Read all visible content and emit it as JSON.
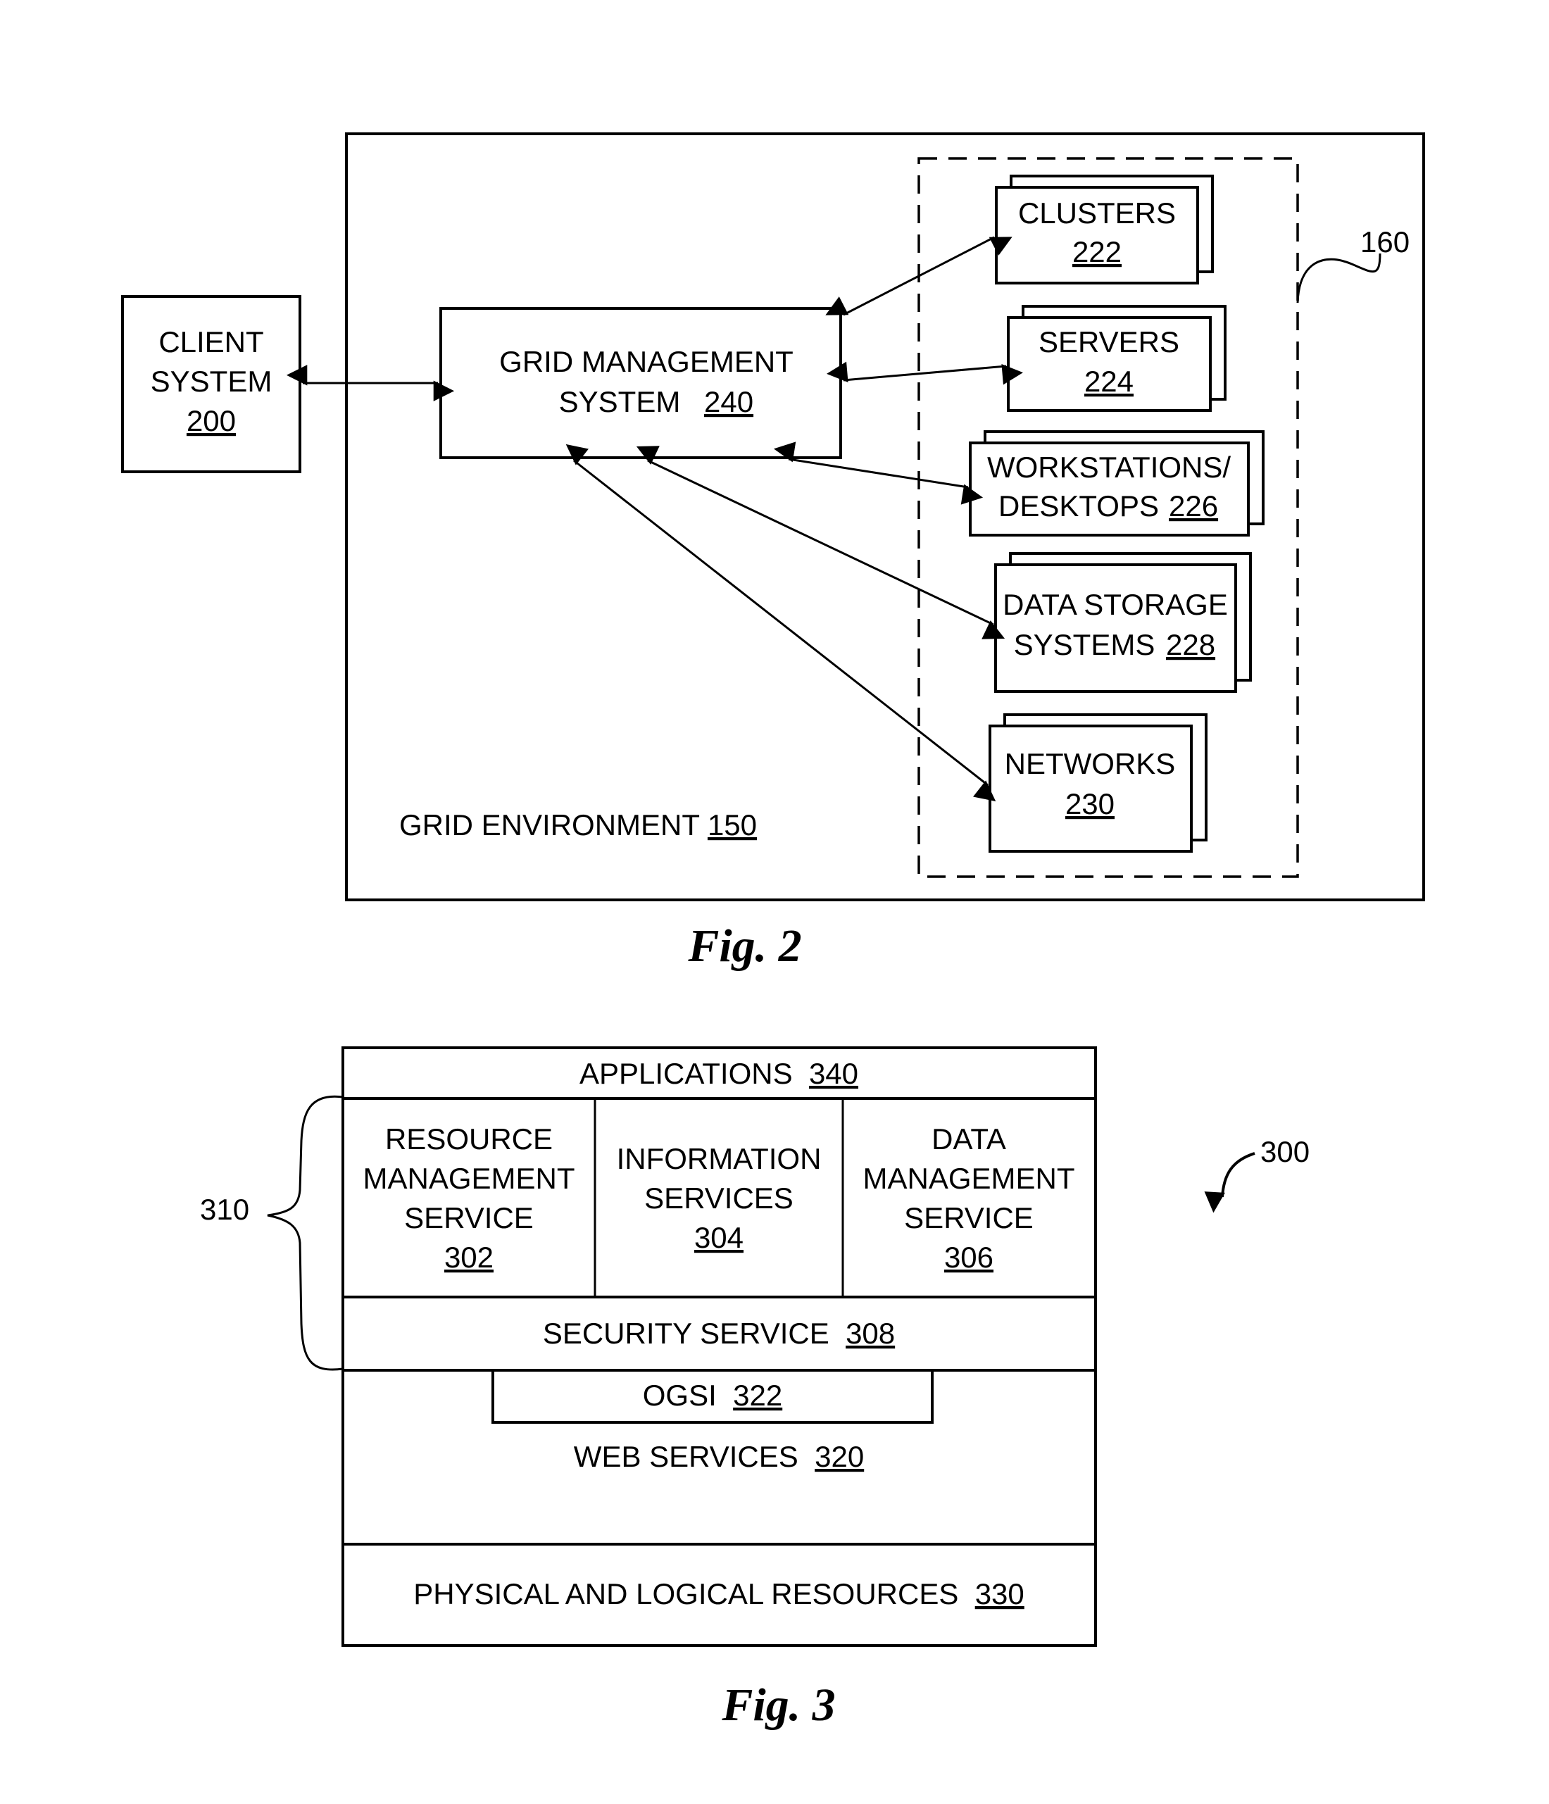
{
  "fig2": {
    "caption": "Fig. 2",
    "grid_environment": {
      "label": "GRID ENVIRONMENT",
      "ref": "150"
    },
    "resource_group_ref": "160",
    "client_system": {
      "lines": [
        "CLIENT",
        "SYSTEM"
      ],
      "ref": "200"
    },
    "grid_management_system": {
      "lines": [
        "GRID MANAGEMENT",
        "SYSTEM"
      ],
      "ref": "240"
    },
    "resources": [
      {
        "id": "clusters",
        "lines": [
          "CLUSTERS"
        ],
        "ref": "222"
      },
      {
        "id": "servers",
        "lines": [
          "SERVERS"
        ],
        "ref": "224"
      },
      {
        "id": "workstations",
        "lines": [
          "WORKSTATIONS/",
          "DESKTOPS"
        ],
        "ref": "226"
      },
      {
        "id": "data-storage",
        "lines": [
          "DATA STORAGE",
          "SYSTEMS"
        ],
        "ref": "228"
      },
      {
        "id": "networks",
        "lines": [
          "NETWORKS"
        ],
        "ref": "230"
      }
    ]
  },
  "fig3": {
    "caption": "Fig. 3",
    "architecture_ref": "300",
    "service_group_ref": "310",
    "applications": {
      "label": "APPLICATIONS",
      "ref": "340"
    },
    "services": [
      {
        "id": "resource-management",
        "lines": [
          "RESOURCE",
          "MANAGEMENT",
          "SERVICE"
        ],
        "ref": "302"
      },
      {
        "id": "information",
        "lines": [
          "INFORMATION",
          "SERVICES"
        ],
        "ref": "304"
      },
      {
        "id": "data-management",
        "lines": [
          "DATA",
          "MANAGEMENT",
          "SERVICE"
        ],
        "ref": "306"
      }
    ],
    "security": {
      "label": "SECURITY SERVICE",
      "ref": "308"
    },
    "ogsi": {
      "label": "OGSI",
      "ref": "322"
    },
    "web_services": {
      "label": "WEB SERVICES",
      "ref": "320"
    },
    "physical": {
      "label": "PHYSICAL AND LOGICAL RESOURCES",
      "ref": "330"
    }
  }
}
